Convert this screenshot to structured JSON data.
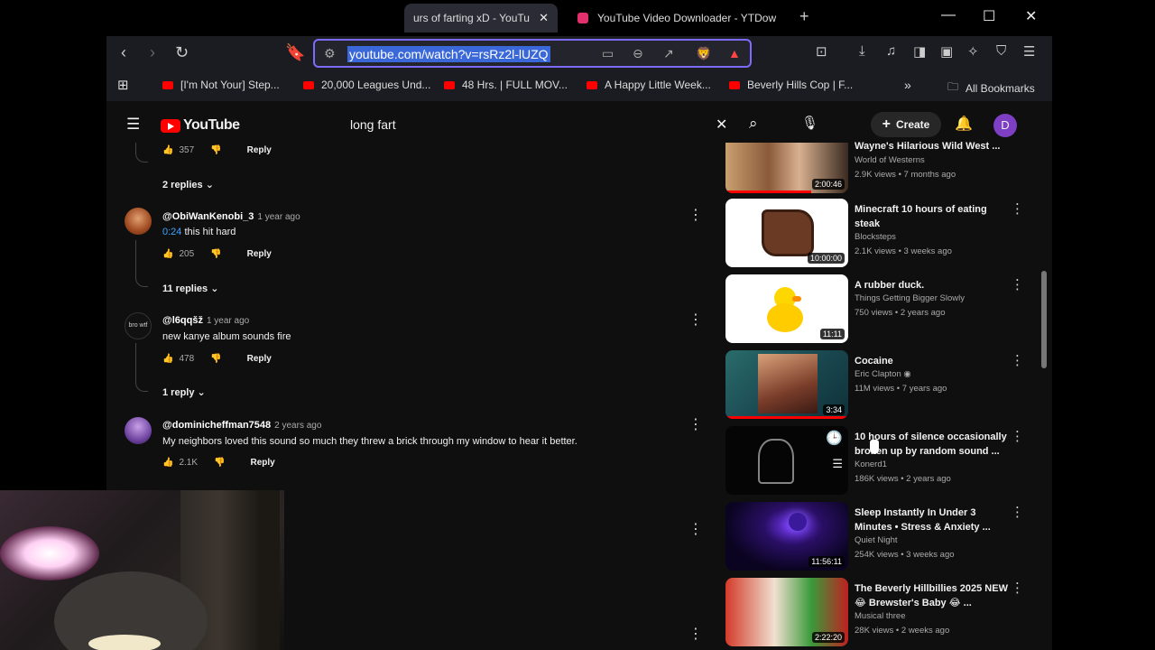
{
  "browser": {
    "tabs": [
      {
        "title": "urs of farting xD - YouTu"
      },
      {
        "title": "YouTube Video Downloader - YTDow"
      }
    ],
    "url": "youtube.com/watch?v=rsRz2l-lUZQ",
    "bookmarks": [
      "[I'm Not Your] Step...",
      "20,000 Leagues Und...",
      "48 Hrs. | FULL MOV...",
      "A Happy Little Week...",
      "Beverly Hills Cop | F..."
    ],
    "all_bookmarks": "All Bookmarks"
  },
  "youtube": {
    "logo": "YouTube",
    "search_query": "long fart",
    "create_label": "Create",
    "avatar_letter": "D"
  },
  "comments": {
    "top": {
      "likes": "357",
      "reply": "Reply",
      "replies": "2 replies"
    },
    "items": [
      {
        "handle": "@ObiWanKenobi_3",
        "ago": "1 year ago",
        "timestamp": "0:24",
        "text": "this hit hard",
        "likes": "205",
        "reply": "Reply",
        "replies": "11 replies"
      },
      {
        "handle": "@l6qqšž",
        "ago": "1 year ago",
        "text": "new kanye album sounds fire",
        "likes": "478",
        "reply": "Reply",
        "replies": "1 reply"
      },
      {
        "handle": "@dominicheffman7548",
        "ago": "2 years ago",
        "text": "My neighbors loved this sound so much they threw a brick through my window to hear it better.",
        "likes": "2.1K",
        "reply": "Reply"
      }
    ]
  },
  "related": [
    {
      "title": "Wayne's Hilarious Wild West ...",
      "channel": "World of Westerns",
      "meta": "2.9K views • 7 months ago",
      "duration": "2:00:46"
    },
    {
      "title": "Minecraft 10 hours of eating steak",
      "channel": "Blocksteps",
      "meta": "2.1K views • 3 weeks ago",
      "duration": "10:00:00"
    },
    {
      "title": "A rubber duck.",
      "channel": "Things Getting Bigger Slowly",
      "meta": "750 views • 2 years ago",
      "duration": "11:11"
    },
    {
      "title": "Cocaine",
      "channel": "Eric Clapton",
      "meta": "11M views • 7 years ago",
      "duration": "3:34"
    },
    {
      "title": "10 hours of silence occasionally broken up by random sound ...",
      "channel": "Konerd1",
      "meta": "186K views • 2 years ago",
      "duration": ""
    },
    {
      "title": "Sleep Instantly In Under 3 Minutes • Stress & Anxiety ...",
      "channel": "Quiet Night",
      "meta": "254K views • 3 weeks ago",
      "duration": "11:56:11"
    },
    {
      "title": "The Beverly Hillbillies 2025 NEW 😂 Brewster's Baby 😂 ...",
      "channel": "Musical three",
      "meta": "28K views • 2 weeks ago",
      "duration": "2:22:20"
    }
  ]
}
